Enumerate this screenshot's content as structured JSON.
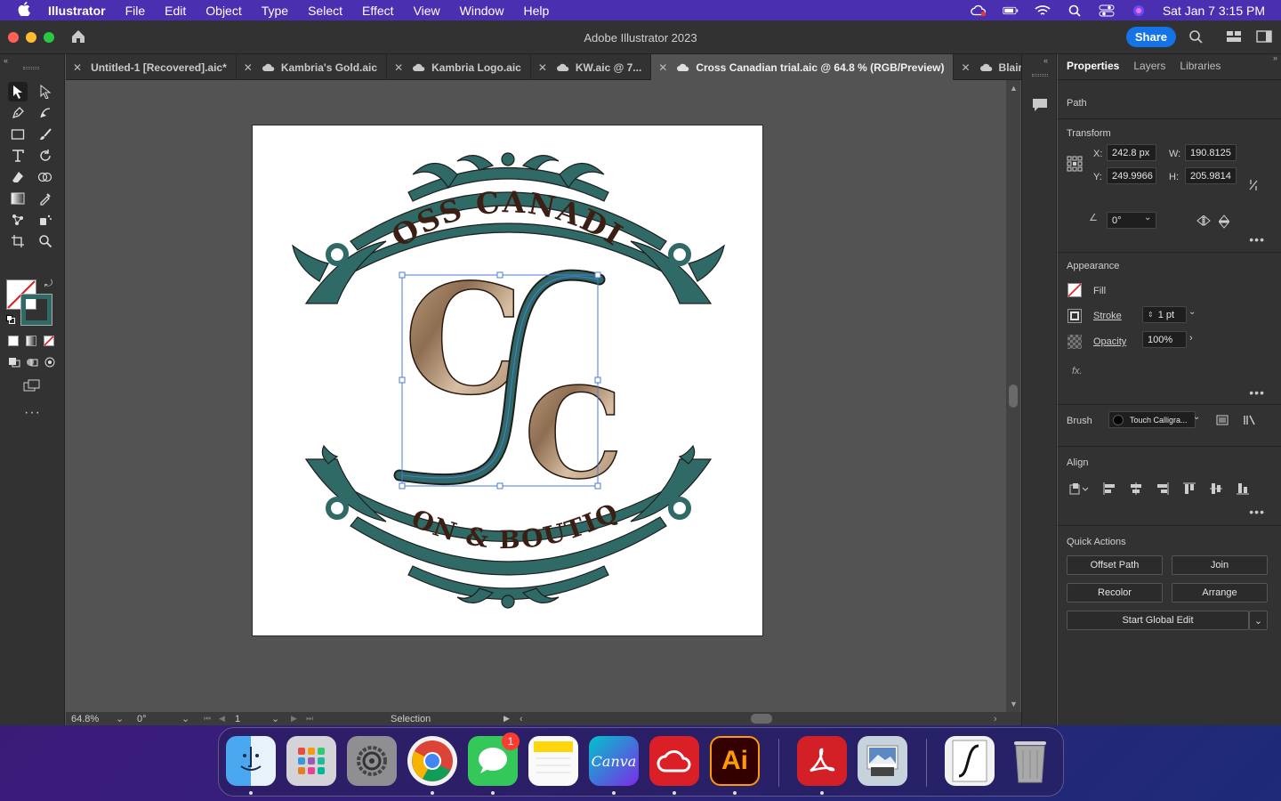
{
  "menubar": {
    "app_name": "Illustrator",
    "items": [
      "File",
      "Edit",
      "Object",
      "Type",
      "Select",
      "Effect",
      "View",
      "Window",
      "Help"
    ],
    "clock": "Sat Jan 7  3:15 PM"
  },
  "window": {
    "title": "Adobe Illustrator 2023",
    "share_label": "Share"
  },
  "tabs": [
    {
      "label": "Untitled-1 [Recovered].aic*",
      "cloud": false,
      "active": false
    },
    {
      "label": "Kambria's Gold.aic",
      "cloud": true,
      "active": false
    },
    {
      "label": "Kambria Logo.aic",
      "cloud": true,
      "active": false
    },
    {
      "label": "KW.aic @ 7...",
      "cloud": true,
      "active": false
    },
    {
      "label": "Cross Canadian trial.aic @ 64.8 % (RGB/Preview)",
      "cloud": true,
      "active": true
    },
    {
      "label": "Blair Cowhide.aic",
      "cloud": true,
      "active": false
    }
  ],
  "artwork": {
    "top_text": "CROSS CANADIAN",
    "bottom_text": "SALON & BOUTIQUE",
    "teal": "#2f6a66",
    "brown": "#3b1f14"
  },
  "status": {
    "zoom": "64.8%",
    "rotation": "0°",
    "artboard": "1",
    "tool": "Selection"
  },
  "properties": {
    "tabs": [
      "Properties",
      "Layers",
      "Libraries"
    ],
    "object_type": "Path",
    "transform": {
      "heading": "Transform",
      "x_label": "X:",
      "x": "242.8 px",
      "y_label": "Y:",
      "y": "249.9966",
      "w_label": "W:",
      "w": "190.8125",
      "h_label": "H:",
      "h": "205.9814",
      "angle": "0°"
    },
    "appearance": {
      "heading": "Appearance",
      "fill_label": "Fill",
      "stroke_label": "Stroke",
      "stroke_value": "1 pt",
      "opacity_label": "Opacity",
      "opacity_value": "100%",
      "fx_label": "fx."
    },
    "brush": {
      "label": "Brush",
      "value": "Touch Calligra..."
    },
    "align": {
      "heading": "Align"
    },
    "quick_actions": {
      "heading": "Quick Actions",
      "offset_path": "Offset Path",
      "join": "Join",
      "recolor": "Recolor",
      "arrange": "Arrange",
      "global_edit": "Start Global Edit"
    }
  },
  "dock": {
    "messages_badge": "1",
    "canva_label": "Canva",
    "ai_label": "Ai"
  }
}
